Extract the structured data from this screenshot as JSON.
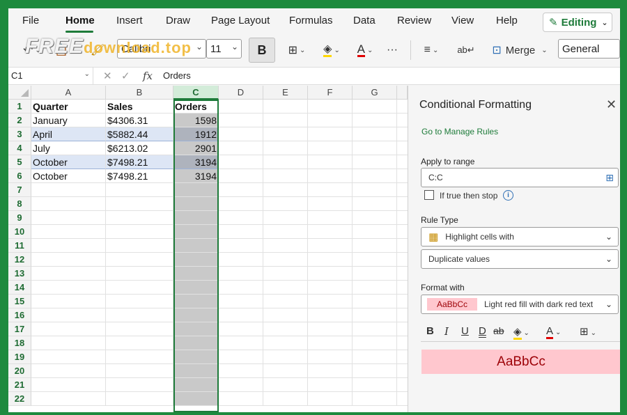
{
  "watermark": {
    "main": "FREE",
    "suffix": "download.top"
  },
  "ribbon": {
    "tabs": [
      "File",
      "Home",
      "Insert",
      "Draw",
      "Page Layout",
      "Formulas",
      "Data",
      "Review",
      "View",
      "Help"
    ],
    "editing_label": "Editing",
    "font_name": "Calibri",
    "font_size": "11",
    "bold_label": "B",
    "merge_label": "Merge",
    "number_format": "General"
  },
  "formula_bar": {
    "name_box": "C1",
    "fx_label": "fx",
    "content": "Orders"
  },
  "sheet": {
    "columns": [
      "A",
      "B",
      "C",
      "D",
      "E",
      "F",
      "G"
    ],
    "selected_column": "C",
    "rows": [
      "1",
      "2",
      "3",
      "4",
      "5",
      "6",
      "7",
      "8",
      "9",
      "10",
      "11",
      "12",
      "13",
      "14",
      "15",
      "16",
      "17",
      "18",
      "19",
      "20",
      "21",
      "22"
    ],
    "header": [
      "Quarter",
      "Sales",
      "Orders"
    ],
    "data": [
      [
        "January",
        "$4306.31",
        "1598"
      ],
      [
        "April",
        "$5882.44",
        "1912"
      ],
      [
        "July",
        "$6213.02",
        "2901"
      ],
      [
        "October",
        "$7498.21",
        "3194"
      ],
      [
        "October",
        "$7498.21",
        "3194"
      ]
    ]
  },
  "pane": {
    "title": "Conditional Formatting",
    "manage_link": "Go to Manage Rules",
    "apply_label": "Apply to range",
    "range_value": "C:C",
    "stop_label": "If true then stop",
    "rule_type_label": "Rule Type",
    "rule_type_value": "Highlight cells with",
    "rule_sub_value": "Duplicate values",
    "format_with_label": "Format with",
    "format_sample": "AaBbCc",
    "format_value": "Light red fill with dark red text",
    "preview_text": "AaBbCc"
  },
  "colors": {
    "accent": "#1e7b3a",
    "dup_fill": "#ffc7ce",
    "dup_text": "#9c0006"
  }
}
